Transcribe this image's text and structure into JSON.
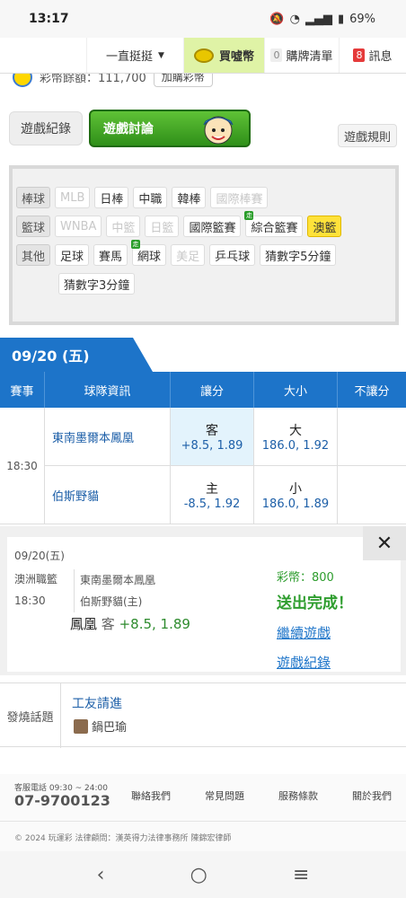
{
  "status": {
    "time": "13:17",
    "battery": "69%"
  },
  "topnav": {
    "dropdown": "一直挺挺",
    "buy": "買噓幣",
    "cart_count": "0",
    "cart": "購牌清單",
    "msg_count": "8",
    "msg": "訊息"
  },
  "balance": {
    "text": "彩幣餘額：111,700",
    "buy_btn": "加購彩幣"
  },
  "tabs": {
    "history": "遊戲紀錄",
    "discuss": "遊戲討論",
    "rules": "遊戲規則"
  },
  "filter": {
    "baseball_label": "棒球",
    "baseball": [
      "MLB",
      "日棒",
      "中職",
      "韓棒",
      "國際棒賽"
    ],
    "basketball_label": "籃球",
    "basketball": [
      "WNBA",
      "中籃",
      "日籃",
      "國際籃賽",
      "綜合籃賽",
      "澳籃"
    ],
    "other_label": "其他",
    "other": [
      "足球",
      "賽馬",
      "網球",
      "美足",
      "乒乓球",
      "猜數字5分鐘",
      "猜數字3分鐘"
    ],
    "live_badge": "走"
  },
  "date": "09/20 (五)",
  "table": {
    "headers": [
      "賽事",
      "球隊資訊",
      "讓分",
      "大小",
      "不讓分"
    ],
    "time": "18:30",
    "rows": [
      {
        "team": "東南墨爾本鳳凰",
        "spread_label": "客",
        "spread_val": "+8.5, 1.89",
        "total_label": "大",
        "total_val": "186.0, 1.92"
      },
      {
        "team": "伯斯野貓",
        "spread_label": "主",
        "spread_val": "-8.5, 1.92",
        "total_label": "小",
        "total_val": "186.0, 1.89"
      }
    ]
  },
  "popup": {
    "close": "✕",
    "date": "09/20(五)",
    "league": "澳洲職籃",
    "time": "18:30",
    "team1": "東南墨爾本鳳凰",
    "team2": "伯斯野貓(主)",
    "pick_team": "鳳凰",
    "pick_side": "客",
    "pick_value": "+8.5, 1.89",
    "coins": "彩幣：800",
    "done": "送出完成！",
    "continue": "繼續遊戲",
    "history": "遊戲紀錄"
  },
  "hot": {
    "label": "發燒話題",
    "title": "工友請進",
    "user": "鍋巴瑜"
  },
  "footer": {
    "service": "客服電話 09:30 ~ 24:00",
    "phone": "07-9700123",
    "links": [
      "聯絡我們",
      "常見問題",
      "服務條款",
      "關於我們"
    ],
    "copyright": "© 2024 玩運彩 法律顧問：漢英得力法律事務所 陳錦宏律師"
  },
  "navbar": {
    "back": "‹",
    "home": "○",
    "recent": "≡"
  }
}
